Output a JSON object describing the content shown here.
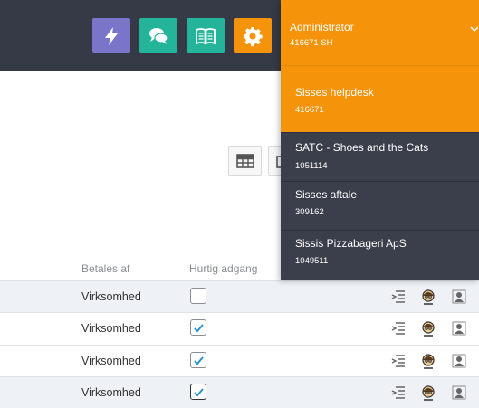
{
  "topbar": {
    "buttons": [
      {
        "icon": "lightning-icon",
        "color": "#7b75c9"
      },
      {
        "icon": "chat-icon",
        "color": "#23b49a"
      },
      {
        "icon": "book-icon",
        "color": "#23b49a"
      },
      {
        "icon": "gear-icon",
        "color": "#f5930a"
      }
    ]
  },
  "account": {
    "role": "Administrator",
    "id": "416671 SH"
  },
  "companies": [
    {
      "name": "Sisses helpdesk",
      "code": "416671",
      "active": true
    },
    {
      "name": "SATC - Shoes and the Cats",
      "code": "1051114",
      "active": false
    },
    {
      "name": "Sisses aftale",
      "code": "309162",
      "active": false
    },
    {
      "name": "Sissis Pizzabageri ApS",
      "code": "1049511",
      "active": false
    }
  ],
  "table": {
    "headers": {
      "payer": "Betales af",
      "quick": "Hurtig adgang"
    },
    "rows": [
      {
        "payer": "Virksomhed",
        "checked": false
      },
      {
        "payer": "Virksomhed",
        "checked": true
      },
      {
        "payer": "Virksomhed",
        "checked": true
      },
      {
        "payer": "Virksomhed",
        "checked": true
      }
    ]
  },
  "colors": {
    "topbar": "#363a47",
    "accent": "#f5930a",
    "dropdown": "#3b3e4b",
    "check": "#2a8fd0"
  }
}
